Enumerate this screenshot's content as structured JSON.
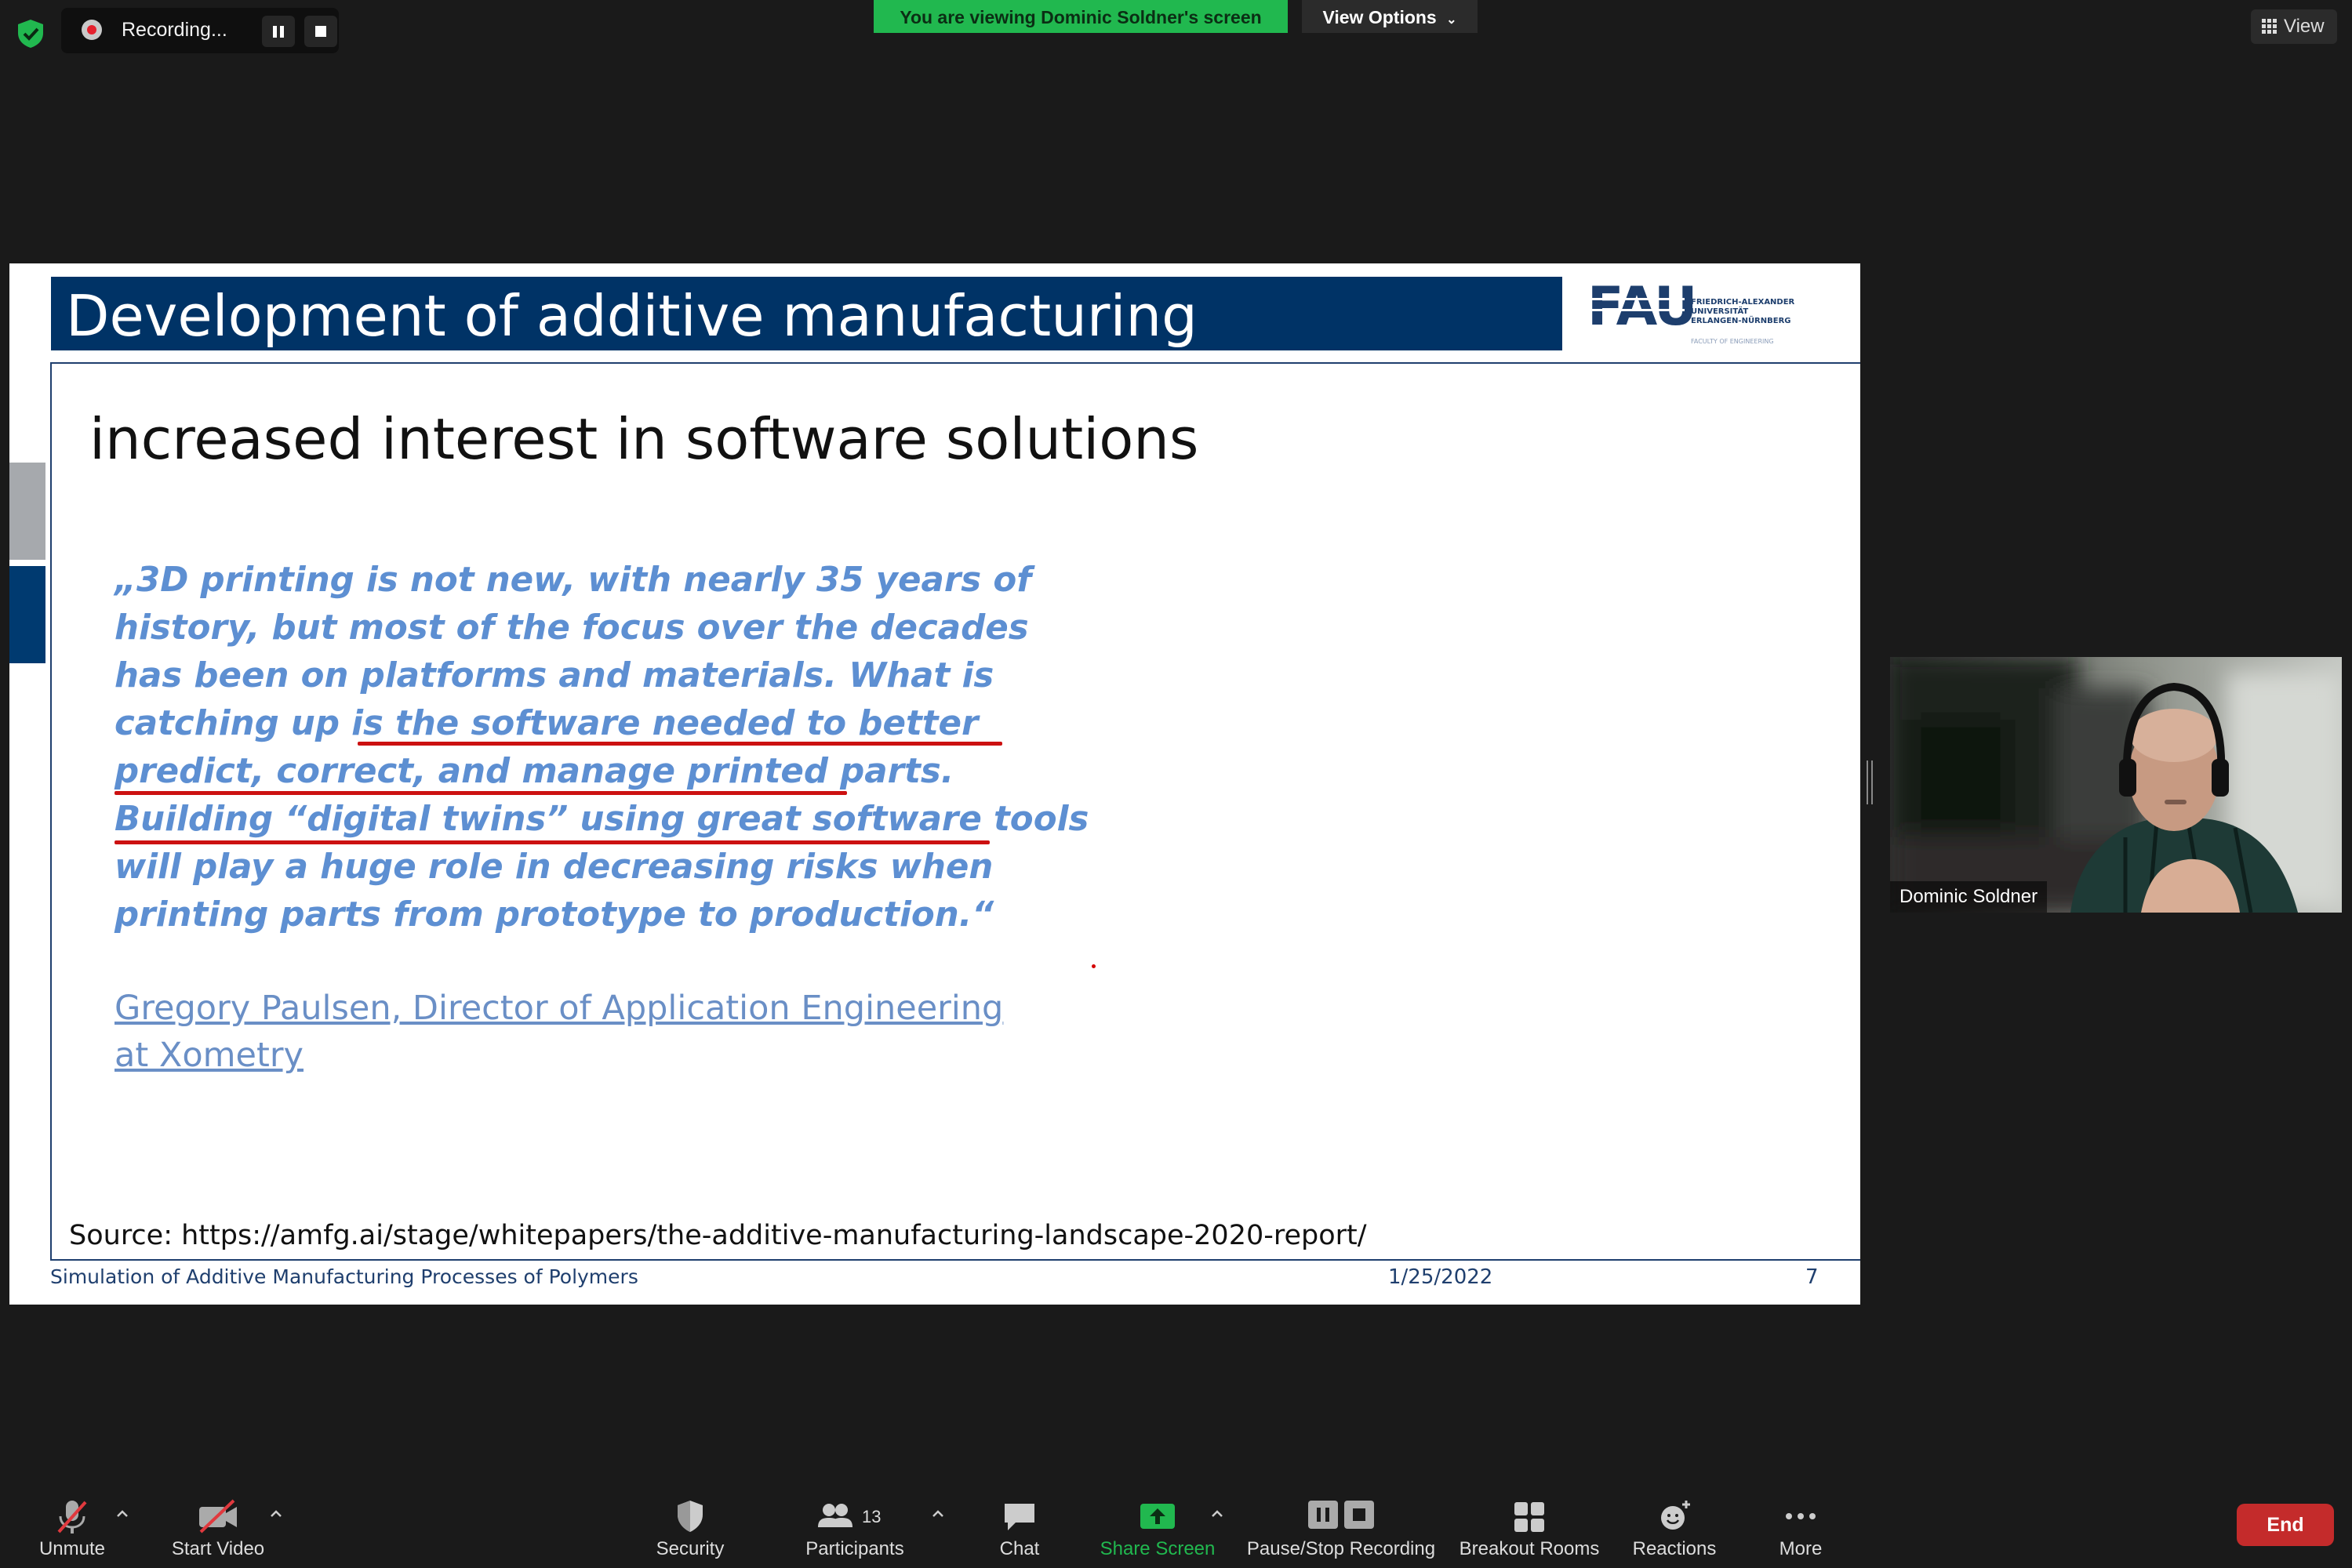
{
  "topbar": {
    "recording_label": "Recording...",
    "viewing_banner": "You are viewing Dominic Soldner's screen",
    "view_options": "View Options",
    "view_label": "View"
  },
  "slide": {
    "title": "Development of additive manufacturing",
    "subtitle": "increased interest in software solutions",
    "quote_lines": [
      "„3D printing is not new, with nearly 35 years of",
      "history, but most of the focus over the decades",
      "has been on platforms and materials. What is",
      "catching up is the software needed to better",
      "predict, correct, and manage printed parts.",
      "Building “digital twins” using great software tools",
      "will play a huge role in decreasing risks when",
      "printing parts from prototype to production.“"
    ],
    "attribution_lines": [
      "Gregory Paulsen, Director of Application Engineering",
      "at Xometry"
    ],
    "source": "Source: https://amfg.ai/stage/whitepapers/the-additive-manufacturing-landscape-2020-report/",
    "footer_title": "Simulation of Additive Manufacturing Processes of Polymers",
    "footer_date": "1/25/2022",
    "footer_page": "7",
    "logo": {
      "mark": "FAU",
      "line1": "FRIEDRICH-ALEXANDER",
      "line2": "UNIVERSITÄT",
      "line3": "ERLANGEN-NÜRNBERG",
      "line4": "FACULTY OF ENGINEERING"
    }
  },
  "video": {
    "participant_name": "Dominic Soldner"
  },
  "toolbar": {
    "unmute": "Unmute",
    "start_video": "Start Video",
    "security": "Security",
    "participants": "Participants",
    "participant_count": "13",
    "chat": "Chat",
    "share_screen": "Share Screen",
    "pause_stop_recording": "Pause/Stop Recording",
    "breakout_rooms": "Breakout Rooms",
    "reactions": "Reactions",
    "more": "More",
    "end": "End"
  },
  "colors": {
    "banner_green": "#21b84f",
    "slide_title_bar": "#003366",
    "quote_blue": "#5d8fd2",
    "underline_red": "#cc1111",
    "end_red": "#c42b2b"
  }
}
